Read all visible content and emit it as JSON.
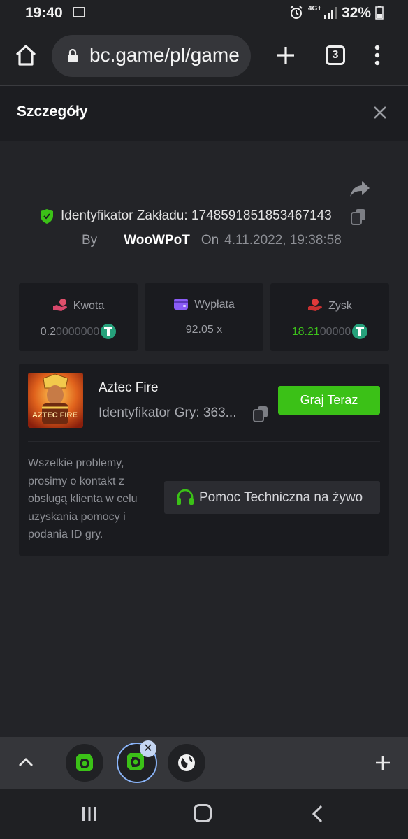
{
  "status_bar": {
    "time": "19:40",
    "network": "4G+",
    "battery": "32%"
  },
  "browser": {
    "url": "bc.game/pl/game",
    "tab_count": "3"
  },
  "header": {
    "title": "Szczegóły"
  },
  "bet": {
    "id_label": "Identyfikator Zakładu: 1748591851853467143",
    "by_label": "By",
    "user": "WooWPoT",
    "on_label": "On",
    "date": "4.11.2022, 19:38:58"
  },
  "stats": {
    "amount": {
      "label": "Kwota",
      "value_main": "0.2",
      "value_dim": "0000000"
    },
    "payout": {
      "label": "Wypłata",
      "value": "92.05 x"
    },
    "profit": {
      "label": "Zysk",
      "value_main": "18.21",
      "value_dim": "00000"
    }
  },
  "game": {
    "thumb_title": "AZTEC FIRE",
    "name": "Aztec Fire",
    "id_label": "Identyfikator Gry: 363...",
    "play_label": "Graj Teraz",
    "help_text": "Wszelkie problemy, prosimy o kontakt z obsługą klienta w celu uzyskania pomocy i podania ID gry.",
    "support_label": "Pomoc Techniczna na żywo"
  },
  "colors": {
    "accent_green": "#3bc117",
    "background": "#232428",
    "card": "#1a1b1f",
    "usdt": "#26a17b"
  }
}
